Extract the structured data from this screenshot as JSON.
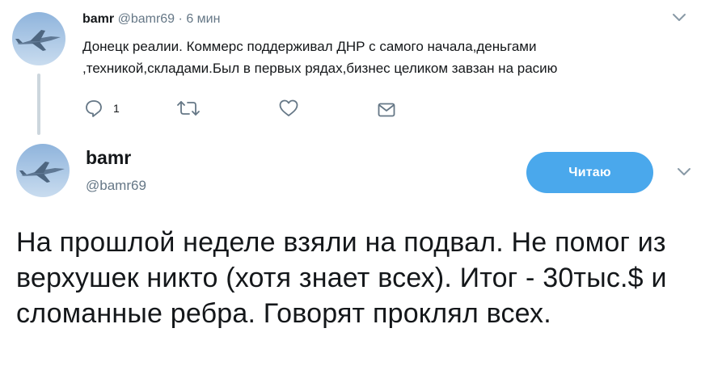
{
  "colors": {
    "accent": "#1da1f2",
    "follow_button": "#4aa8ec",
    "secondary_text": "#657786",
    "thread_line": "#ccd6dd"
  },
  "reply_tweet": {
    "author_name": "bamr",
    "author_handle": "@bamr69",
    "separator": "·",
    "time": "6 мин",
    "text": "Донецк реалии. Коммерс поддерживал ДНР с самого начала,деньгами ,техникой,складами.Был в первых рядах,бизнес целиком завзан на расию",
    "actions": {
      "reply_icon": "reply-icon",
      "reply_count": "1",
      "retweet_icon": "retweet-icon",
      "like_icon": "heart-icon",
      "message_icon": "envelope-icon"
    }
  },
  "main_tweet": {
    "author_name": "bamr",
    "author_handle": "@bamr69",
    "follow_label": "Читаю",
    "text": "На прошлой неделе взяли на подвал. Не помог из верхушек никто (хотя знает всех). Итог - 30тыс.$ и сломанные ребра. Говорят проклял всех."
  }
}
